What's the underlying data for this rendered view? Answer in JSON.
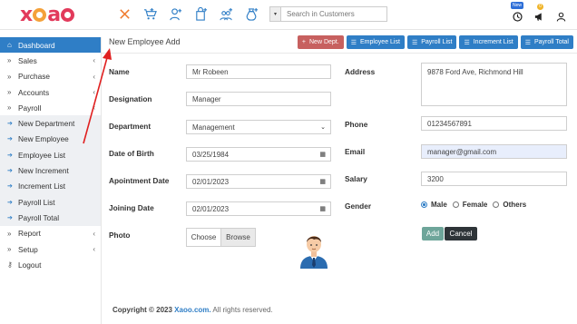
{
  "app": {
    "logo_text": "xaoo",
    "search_placeholder": "Search in Customers",
    "new_badge": "New",
    "notif_count": "0"
  },
  "sidebar": {
    "items": [
      {
        "label": "Dashboard",
        "icon": "home-icon",
        "active": true
      },
      {
        "label": "Sales",
        "icon": "double-chevron-icon",
        "chev": "‹"
      },
      {
        "label": "Purchase",
        "icon": "double-chevron-icon",
        "chev": "‹"
      },
      {
        "label": "Accounts",
        "icon": "double-chevron-icon",
        "chev": "‹"
      },
      {
        "label": "Payroll",
        "icon": "double-chevron-icon",
        "chev": "‹"
      },
      {
        "label": "New Department",
        "icon": "circle-arrow-icon",
        "sub": true
      },
      {
        "label": "New Employee",
        "icon": "circle-arrow-icon",
        "sub": true
      },
      {
        "label": "Employee List",
        "icon": "circle-arrow-icon",
        "sub": true
      },
      {
        "label": "New Increment",
        "icon": "circle-arrow-icon",
        "sub": true
      },
      {
        "label": "Increment List",
        "icon": "circle-arrow-icon",
        "sub": true
      },
      {
        "label": "Payroll List",
        "icon": "circle-arrow-icon",
        "sub": true
      },
      {
        "label": "Payroll Total",
        "icon": "circle-arrow-icon",
        "sub": true
      },
      {
        "label": "Report",
        "icon": "double-chevron-icon",
        "chev": "‹"
      },
      {
        "label": "Setup",
        "icon": "double-chevron-icon",
        "chev": "‹"
      },
      {
        "label": "Logout",
        "icon": "key-icon"
      }
    ]
  },
  "page": {
    "title": "New Employee Add",
    "buttons": {
      "new_dept": "New Dept.",
      "employee_list": "Employee List",
      "payroll_list": "Payroll List",
      "increment_list": "Increment List",
      "payroll_total": "Payroll Total"
    }
  },
  "form": {
    "name_label": "Name",
    "name_value": "Mr Robeen",
    "designation_label": "Designation",
    "designation_value": "Manager",
    "department_label": "Department",
    "department_value": "Management",
    "dob_label": "Date of Birth",
    "dob_value": "03/25/1984",
    "appointment_label": "Apointment Date",
    "appointment_value": "02/01/2023",
    "joining_label": "Joining Date",
    "joining_value": "02/01/2023",
    "photo_label": "Photo",
    "choose_label": "Choose",
    "browse_label": "Browse",
    "address_label": "Address",
    "address_value": "9878 Ford Ave, Richmond Hill",
    "phone_label": "Phone",
    "phone_value": "01234567891",
    "email_label": "Email",
    "email_value": "manager@gmail.com",
    "salary_label": "Salary",
    "salary_value": "3200",
    "gender_label": "Gender",
    "gender_options": [
      "Male",
      "Female",
      "Others"
    ],
    "gender_selected": "Male",
    "add_button": "Add",
    "cancel_button": "Cancel"
  },
  "footer": {
    "prefix": "Copyright © 2023",
    "brand": "Xaoo.com.",
    "suffix": "All rights reserved."
  },
  "colors": {
    "accent": "#2f7ec6",
    "brand_red": "#e23a5b",
    "brand_orange": "#f4a13a",
    "new_dept_button": "#c7605f"
  }
}
